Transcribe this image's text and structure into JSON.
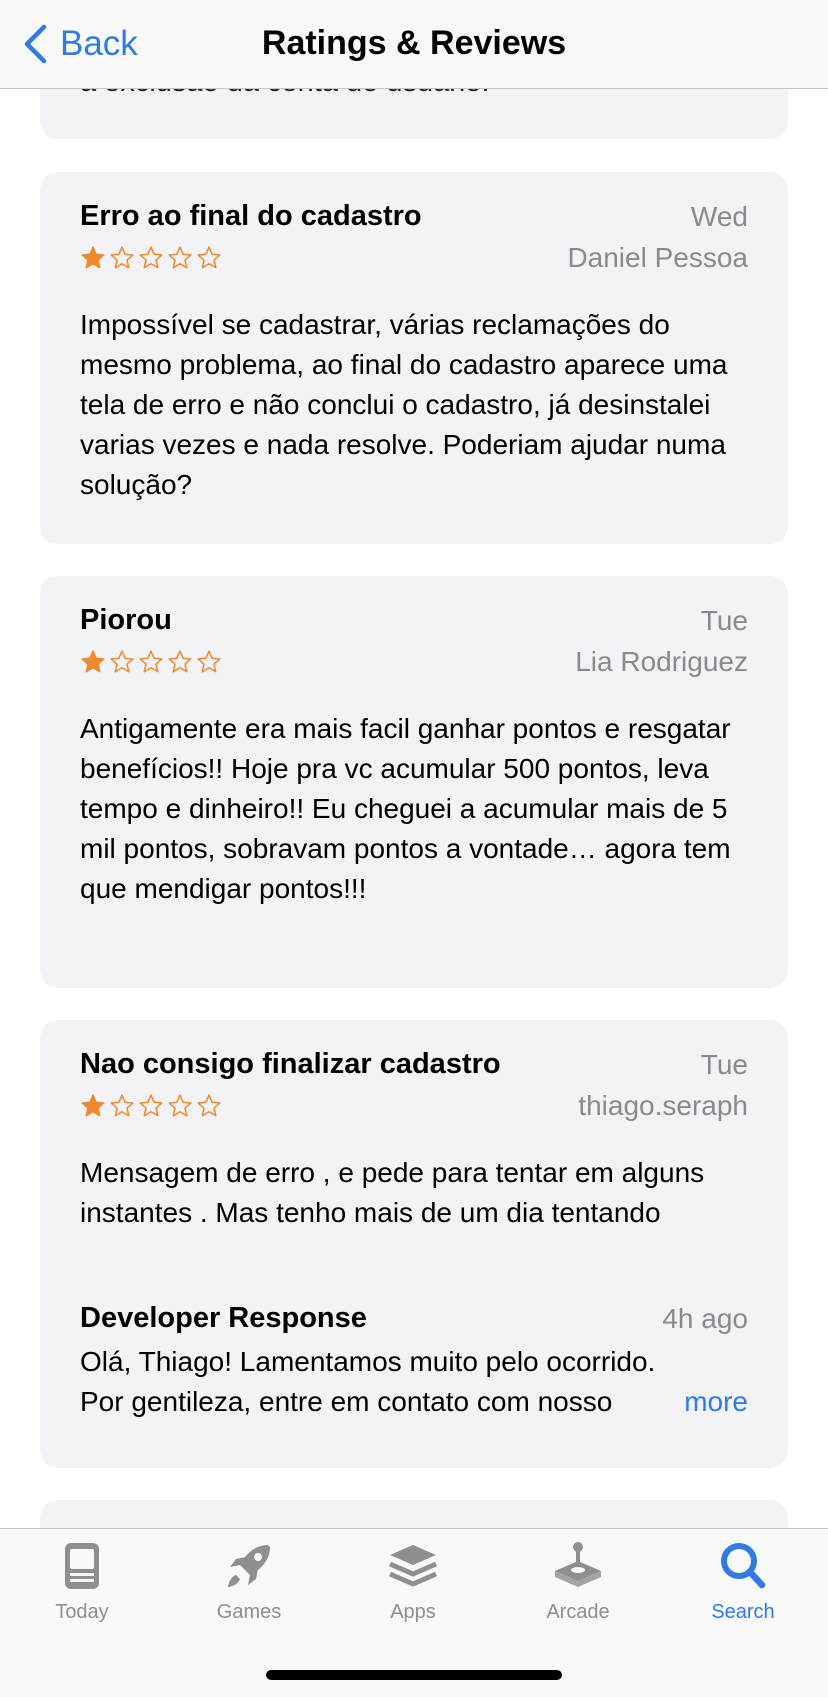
{
  "nav": {
    "back_label": "Back",
    "title": "Ratings & Reviews"
  },
  "previous_review_tail": "a exclusão da conta do usuário.",
  "reviews": [
    {
      "title": "Erro ao final do cadastro",
      "date": "Wed",
      "author": "Daniel Pessoa",
      "rating": 1,
      "body": "Impossível se cadastrar, várias reclamações do mesmo problema, ao final do cadastro aparece uma tela de erro e não conclui o cadastro, já desinstalei varias vezes e nada resolve. Poderiam ajudar numa solução?"
    },
    {
      "title": "Piorou",
      "date": "Tue",
      "author": "Lia Rodriguez",
      "rating": 1,
      "body": "Antigamente era mais facil ganhar pontos e resgatar benefícios!! Hoje pra vc acumular 500 pontos, leva tempo e dinheiro!! Eu cheguei a acumular mais de 5 mil pontos, sobravam pontos a vontade… agora tem que mendigar pontos!!!"
    },
    {
      "title": "Nao consigo finalizar cadastro",
      "date": "Tue",
      "author": "thiago.seraph",
      "rating": 1,
      "body": "Mensagem de erro , e pede para tentar em alguns instantes . Mas tenho mais de um dia tentando",
      "developer_response": {
        "label": "Developer Response",
        "time": "4h ago",
        "line1": "Olá, Thiago! Lamentamos muito pelo ocorrido.",
        "line2": "Por gentileza, entre em contato com nosso",
        "more_label": "more"
      }
    }
  ],
  "tabs": [
    {
      "label": "Today",
      "icon": "today-icon",
      "active": false
    },
    {
      "label": "Games",
      "icon": "rocket-icon",
      "active": false
    },
    {
      "label": "Apps",
      "icon": "layers-icon",
      "active": false
    },
    {
      "label": "Arcade",
      "icon": "joystick-icon",
      "active": false
    },
    {
      "label": "Search",
      "icon": "search-icon",
      "active": true
    }
  ],
  "colors": {
    "accent": "#2f7ae5",
    "star": "#f0892c",
    "card_bg": "#f2f2f7",
    "secondary_text": "#8a8a8e"
  }
}
